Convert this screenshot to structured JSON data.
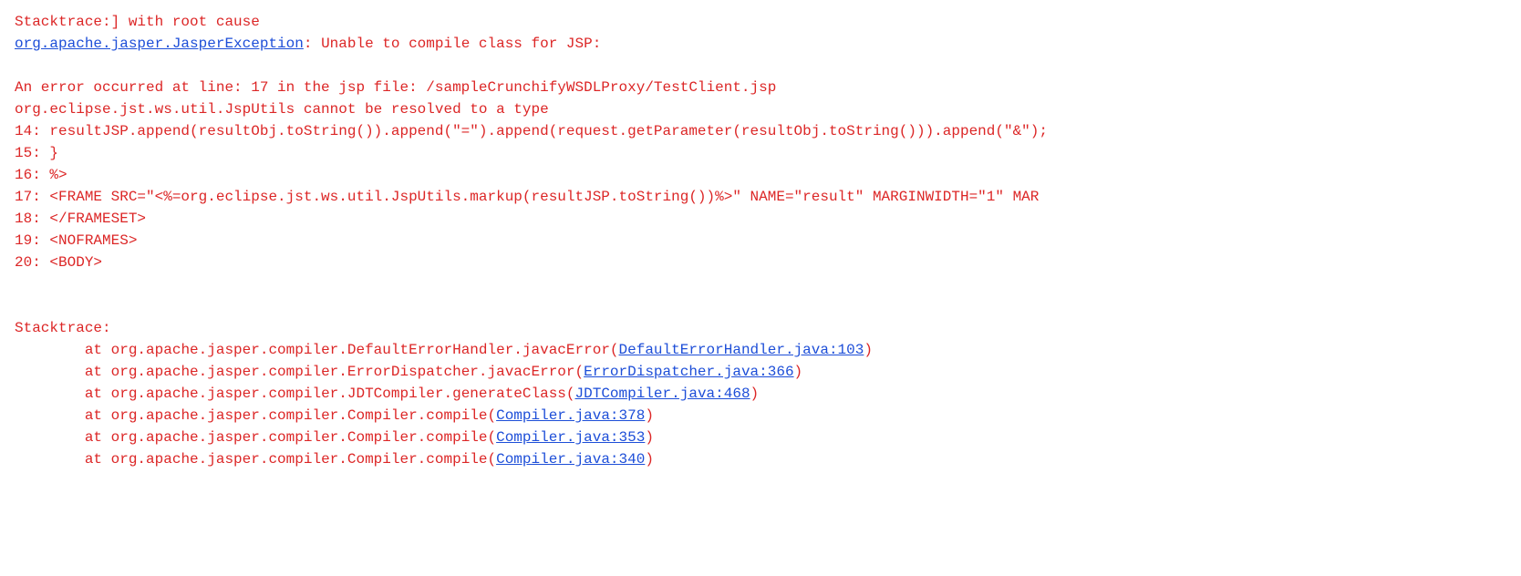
{
  "header": {
    "line1_pre": "Stacktrace:] with root cause",
    "exception_class": "org.apache.jasper.JasperException",
    "exception_sep": ": ",
    "exception_msg": "Unable to compile class for JSP:"
  },
  "error_block": {
    "blank": "",
    "loc": "An error occurred at line: 17 in the jsp file: /sampleCrunchifyWSDLProxy/TestClient.jsp",
    "cause": "org.eclipse.jst.ws.util.JspUtils cannot be resolved to a type",
    "src14": "14: resultJSP.append(resultObj.toString()).append(\"=\").append(request.getParameter(resultObj.toString())).append(\"&\");",
    "src15": "15: }",
    "src16": "16: %>",
    "src17": "17: <FRAME SRC=\"<%=org.eclipse.jst.ws.util.JspUtils.markup(resultJSP.toString())%>\" NAME=\"result\"  MARGINWIDTH=\"1\" MAR",
    "src18": "18: </FRAMESET>",
    "src19": "19: <NOFRAMES>",
    "src20": "20: <BODY>"
  },
  "trace": {
    "header": "Stacktrace:",
    "at": "at ",
    "frames": [
      {
        "pkg": "org.apache.jasper.compiler.DefaultErrorHandler.javacError(",
        "link": "DefaultErrorHandler.java:103",
        "close": ")"
      },
      {
        "pkg": "org.apache.jasper.compiler.ErrorDispatcher.javacError(",
        "link": "ErrorDispatcher.java:366",
        "close": ")"
      },
      {
        "pkg": "org.apache.jasper.compiler.JDTCompiler.generateClass(",
        "link": "JDTCompiler.java:468",
        "close": ")"
      },
      {
        "pkg": "org.apache.jasper.compiler.Compiler.compile(",
        "link": "Compiler.java:378",
        "close": ")"
      },
      {
        "pkg": "org.apache.jasper.compiler.Compiler.compile(",
        "link": "Compiler.java:353",
        "close": ")"
      },
      {
        "pkg": "org.apache.jasper.compiler.Compiler.compile(",
        "link": "Compiler.java:340",
        "close": ")"
      }
    ]
  }
}
